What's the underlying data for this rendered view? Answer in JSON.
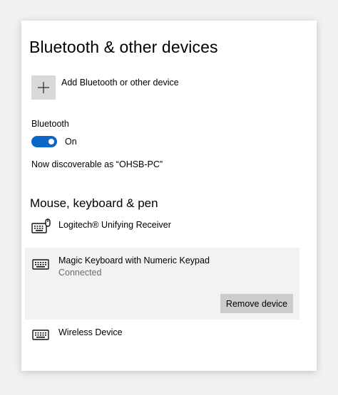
{
  "page": {
    "title": "Bluetooth & other devices"
  },
  "add_device": {
    "label": "Add Bluetooth or other device",
    "icon": "plus-icon"
  },
  "bluetooth": {
    "label": "Bluetooth",
    "toggle_state": "On",
    "toggle_on": true,
    "discoverable_text": "Now discoverable as “OHSB-PC”"
  },
  "section": {
    "title": "Mouse, keyboard & pen"
  },
  "devices": [
    {
      "name": "Logitech® Unifying Receiver",
      "icon": "keyboard-mouse-icon"
    },
    {
      "name": "Magic Keyboard with Numeric Keypad",
      "status": "Connected",
      "icon": "keyboard-icon",
      "action_label": "Remove device"
    },
    {
      "name": "Wireless Device",
      "icon": "keyboard-icon"
    }
  ],
  "colors": {
    "accent": "#0a67c9",
    "tile": "#d9d9d9",
    "selected_row": "#f2f2f2",
    "button": "#cccccc",
    "secondary_text": "#6b6b6b"
  }
}
